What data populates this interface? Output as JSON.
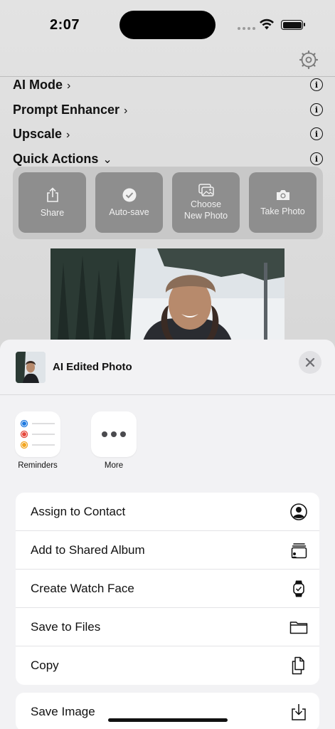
{
  "status_bar": {
    "time": "2:07"
  },
  "menu": [
    {
      "label": "AI Mode",
      "chevron": "›"
    },
    {
      "label": "Prompt Enhancer",
      "chevron": "›"
    },
    {
      "label": "Upscale",
      "chevron": "›"
    },
    {
      "label": "Quick Actions",
      "chevron": "⌄"
    }
  ],
  "quick_actions": [
    {
      "label": "Share",
      "icon": "share-icon"
    },
    {
      "label": "Auto-save",
      "icon": "checkmark-circle-icon"
    },
    {
      "label": "Choose New Photo",
      "icon": "photos-icon"
    },
    {
      "label": "Take Photo",
      "icon": "camera-icon"
    }
  ],
  "share_sheet": {
    "title": "AI Edited Photo",
    "apps": [
      {
        "label": "Reminders",
        "icon": "reminders-icon"
      },
      {
        "label": "More",
        "icon": "more-icon"
      }
    ],
    "actions": [
      {
        "label": "Assign to Contact",
        "icon": "person-circle-icon"
      },
      {
        "label": "Add to Shared Album",
        "icon": "shared-album-icon"
      },
      {
        "label": "Create Watch Face",
        "icon": "watch-icon"
      },
      {
        "label": "Save to Files",
        "icon": "folder-icon"
      },
      {
        "label": "Copy",
        "icon": "copy-icon"
      }
    ],
    "actions2": [
      {
        "label": "Save Image",
        "icon": "save-download-icon"
      }
    ]
  },
  "colors": {
    "reminder_blue": "#1f7ae0",
    "reminder_red": "#e5483c",
    "reminder_orange": "#f2a51e"
  }
}
